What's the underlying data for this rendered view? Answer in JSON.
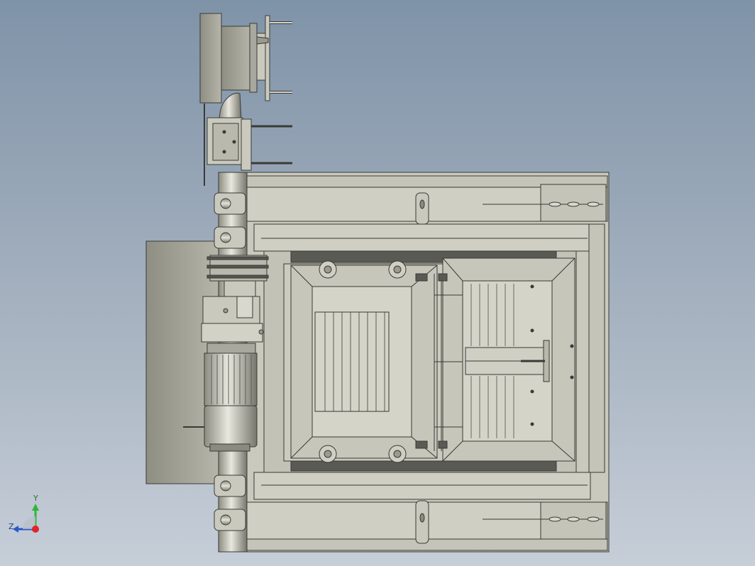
{
  "viewport": {
    "background_top": "#7f93a8",
    "background_bottom": "#c6ced8"
  },
  "model": {
    "body_color": "#c9c9bd",
    "shadow_color": "#8a8a7f",
    "line_color": "#3a3a36",
    "dark_band_color": "#55554f"
  },
  "triad": {
    "y_label": "Y",
    "z_label": "Z",
    "y_color": "#2fb53a",
    "z_color": "#2a57c9",
    "x_color": "#e0242a"
  }
}
